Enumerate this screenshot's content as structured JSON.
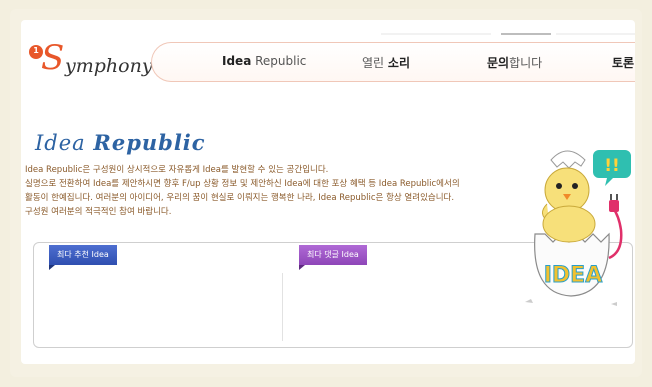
{
  "logo": {
    "number": "1",
    "initial": "S",
    "rest": "ymphony"
  },
  "nav": {
    "items": [
      {
        "bold": "Idea",
        "light": " Republic"
      },
      {
        "light": "열린 ",
        "bold": "소리"
      },
      {
        "bold": "문의",
        "light": "합니다"
      },
      {
        "bold": "토론",
        "light": ""
      }
    ]
  },
  "page": {
    "title_light": "Idea ",
    "title_strong": "Republic",
    "description": [
      "Idea Republic은 구성원이 상시적으로 자유롭게 Idea를 발현할 수 있는 공간입니다.",
      "실명으로 전환하여 Idea를 제안하시면 향후 F/up 상황 정보 및 제안하신 Idea에 대한 포상 혜택 등 Idea Republic에서의",
      "활동이 한예집니다. 여러분의 아이디어, 우리의 꿈이 현실로 이뤄지는 행복한 나라, Idea Republic은 항상 열려있습니다.",
      "구성원 여러분의 적극적인 참여 바랍니다."
    ]
  },
  "sections": {
    "left_tab": "최다 추천 Idea",
    "right_tab": "최다 댓글 Idea"
  },
  "mascot": {
    "badge_text": "!!",
    "sign_text": "IDEA"
  },
  "colors": {
    "accent_orange": "#e8572a",
    "title_blue": "#2d63a3",
    "desc_brown": "#8a5a2a",
    "tab_blue": "#3a5cc0",
    "tab_purple": "#a05ac8",
    "background": "#f3efdf"
  }
}
